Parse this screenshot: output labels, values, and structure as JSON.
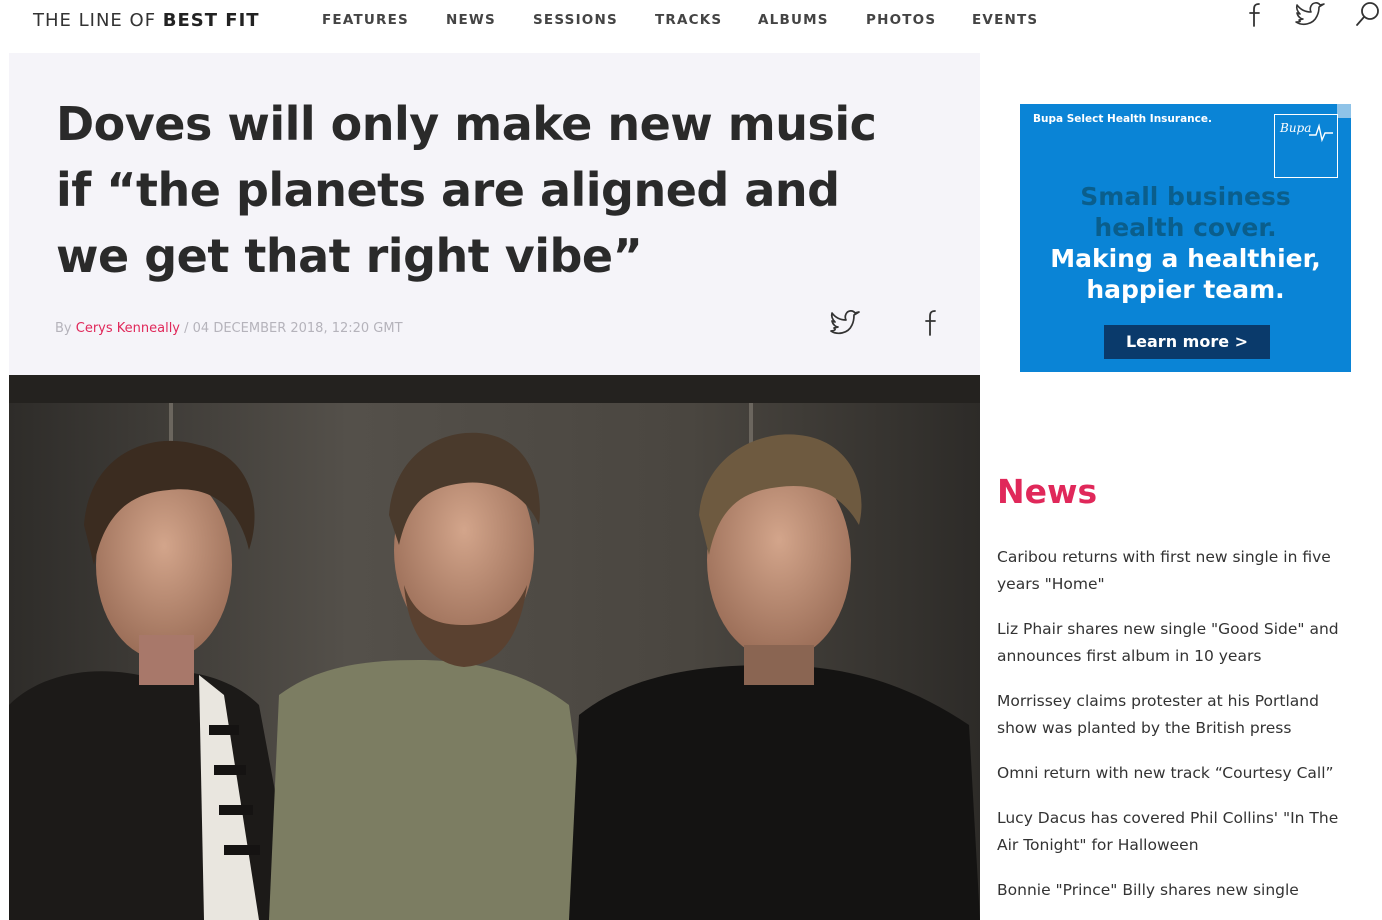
{
  "site": {
    "logo_light": "THE LINE OF ",
    "logo_bold": "BEST FIT"
  },
  "nav": {
    "items": [
      "FEATURES",
      "NEWS",
      "SESSIONS",
      "TRACKS",
      "ALBUMS",
      "PHOTOS",
      "EVENTS"
    ]
  },
  "header_icons": [
    "facebook-icon",
    "twitter-icon",
    "search-icon"
  ],
  "article": {
    "headline": "Doves will only make new music if “the planets are aligned and we get that right vibe”",
    "byline_prefix": "By ",
    "author": "Cerys Kenneally",
    "byline_suffix": " / 04 DECEMBER 2018, 12:20 GMT",
    "share_icons": [
      "twitter-icon",
      "facebook-icon"
    ]
  },
  "ad": {
    "brand": "Bupa Select Health Insurance.",
    "logo_text": "Bupa",
    "line1a": "Small business",
    "line1b": "health cover.",
    "line2a": "Making a healthier,",
    "line2b": "happier team.",
    "cta": "Learn more >"
  },
  "news": {
    "title": "News",
    "items": [
      "Caribou returns with first new single in five years \"Home\"",
      "Liz Phair shares new single \"Good Side\" and announces first album in 10 years",
      "Morrissey claims protester at his Portland show was planted by the British press",
      "Omni return with new track “Courtesy Call”",
      "Lucy Dacus has covered Phil Collins' \"In The Air Tonight\" for Halloween",
      "Bonnie \"Prince\" Billy shares new single"
    ]
  },
  "colors": {
    "accent": "#e0285a",
    "ad_blue": "#0a84d6",
    "ad_navy": "#0a3a6b"
  }
}
